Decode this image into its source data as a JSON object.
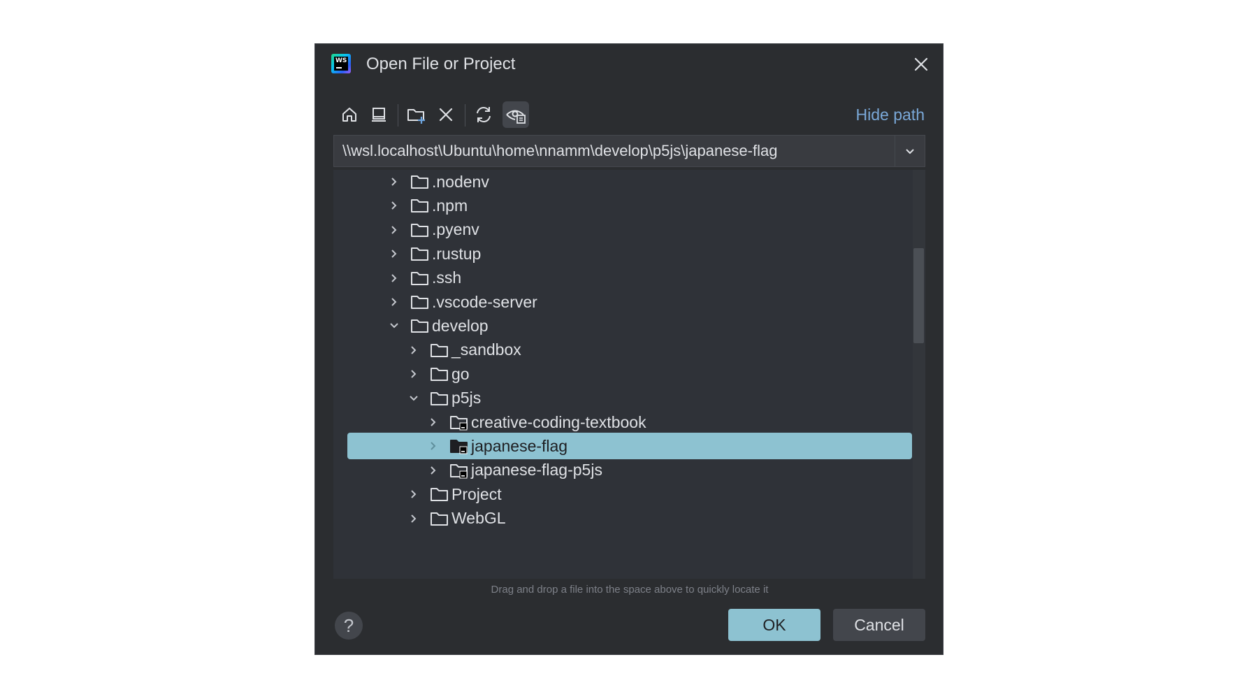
{
  "dialog": {
    "title": "Open File or Project",
    "logo_text": "WS"
  },
  "toolbar": {
    "buttons": [
      {
        "icon": "home-icon"
      },
      {
        "icon": "desktop-icon"
      },
      {
        "icon": "new-folder-icon"
      },
      {
        "icon": "delete-icon"
      },
      {
        "icon": "refresh-icon"
      },
      {
        "icon": "show-hidden-icon",
        "active": true
      }
    ],
    "hide_path_label": "Hide path"
  },
  "path": {
    "value": "\\\\wsl.localhost\\Ubuntu\\home\\nnamm\\develop\\p5js\\japanese-flag"
  },
  "tree": {
    "items": [
      {
        "label": ".nodenv",
        "depth": 0,
        "expanded": false,
        "project": false,
        "selected": false
      },
      {
        "label": ".npm",
        "depth": 0,
        "expanded": false,
        "project": false,
        "selected": false
      },
      {
        "label": ".pyenv",
        "depth": 0,
        "expanded": false,
        "project": false,
        "selected": false
      },
      {
        "label": ".rustup",
        "depth": 0,
        "expanded": false,
        "project": false,
        "selected": false
      },
      {
        "label": ".ssh",
        "depth": 0,
        "expanded": false,
        "project": false,
        "selected": false
      },
      {
        "label": ".vscode-server",
        "depth": 0,
        "expanded": false,
        "project": false,
        "selected": false
      },
      {
        "label": "develop",
        "depth": 0,
        "expanded": true,
        "project": false,
        "selected": false
      },
      {
        "label": "_sandbox",
        "depth": 1,
        "expanded": false,
        "project": false,
        "selected": false
      },
      {
        "label": "go",
        "depth": 1,
        "expanded": false,
        "project": false,
        "selected": false
      },
      {
        "label": "p5js",
        "depth": 1,
        "expanded": true,
        "project": false,
        "selected": false
      },
      {
        "label": "creative-coding-textbook",
        "depth": 2,
        "expanded": false,
        "project": true,
        "selected": false
      },
      {
        "label": "japanese-flag",
        "depth": 2,
        "expanded": false,
        "project": true,
        "selected": true
      },
      {
        "label": "japanese-flag-p5js",
        "depth": 2,
        "expanded": false,
        "project": true,
        "selected": false
      },
      {
        "label": "Project",
        "depth": 1,
        "expanded": false,
        "project": false,
        "selected": false
      },
      {
        "label": "WebGL",
        "depth": 1,
        "expanded": false,
        "project": false,
        "selected": false
      }
    ]
  },
  "hint": "Drag and drop a file into the space above to quickly locate it",
  "footer": {
    "help_label": "?",
    "ok_label": "OK",
    "cancel_label": "Cancel"
  },
  "colors": {
    "background": "#2b2d30",
    "accent": "#8dc2d1",
    "link": "#7aa8d8"
  }
}
